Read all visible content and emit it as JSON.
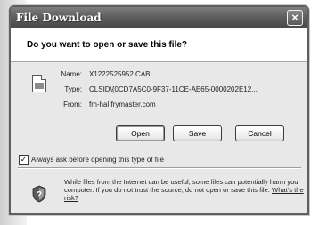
{
  "dialog": {
    "title": "File Download",
    "close_symbol": "×",
    "question": "Do you want to open or save this file?"
  },
  "file": {
    "icon": "file-icon",
    "name_label": "Name:",
    "name_value": "X1222525952.CAB",
    "type_label": "Type:",
    "type_value": "CLSID\\{0CD7A5C0-9F37-11CE-AE65-0000202E12...",
    "from_label": "From:",
    "from_value": "fm-hal.frymaster.com"
  },
  "buttons": {
    "open": "Open",
    "save": "Save",
    "cancel": "Cancel"
  },
  "checkbox": {
    "checked": true,
    "check_mark": "✓",
    "label": "Always ask before opening this type of file"
  },
  "warning": {
    "icon": "shield-question-icon",
    "text": "While files from the Internet can be useful, some files can potentially harm your computer. If you do not trust the source, do not open or save this file.",
    "link": "What's the risk?"
  }
}
